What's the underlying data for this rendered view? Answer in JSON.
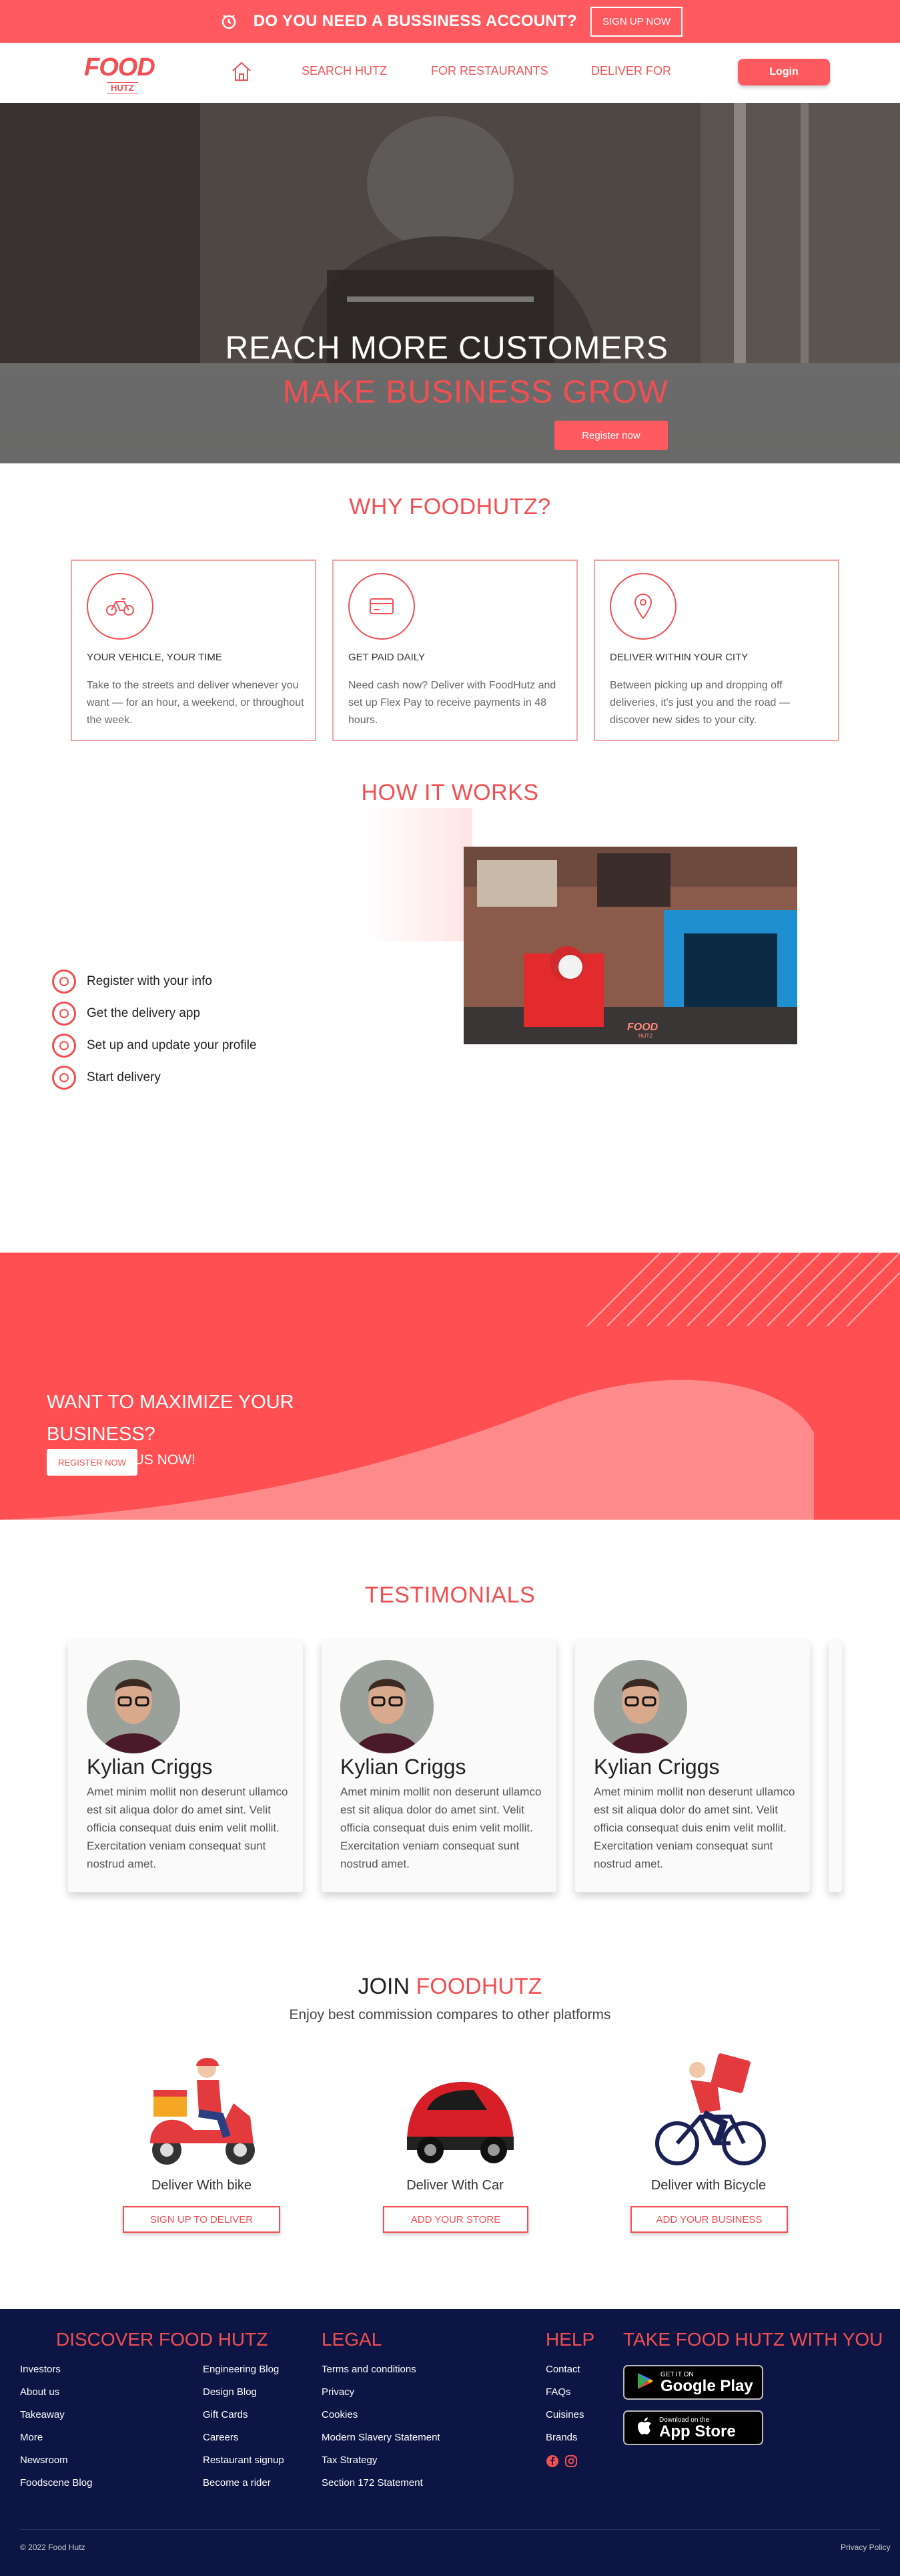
{
  "banner": {
    "text": "DO YOU NEED A BUSSINESS ACCOUNT?",
    "button": "SIGN UP NOW"
  },
  "nav": {
    "logo_top": "FOOD",
    "logo_bottom": "HUTZ",
    "links": [
      "SEARCH HUTZ",
      "FOR RESTAURANTS",
      "DELIVER FOR"
    ],
    "login": "Login"
  },
  "hero": {
    "line1": "REACH MORE CUSTOMERS",
    "line2": "MAKE BUSINESS GROW",
    "button": "Register now"
  },
  "why": {
    "title": "WHY FOODHUTZ?",
    "cards": [
      {
        "icon": "bike-icon",
        "title": "YOUR VEHICLE, YOUR TIME",
        "text": "Take to the streets and deliver whenever you want — for an hour, a weekend, or throughout the week."
      },
      {
        "icon": "card-icon",
        "title": "GET PAID DAILY",
        "text": "Need cash now? Deliver with FoodHutz and set up Flex Pay to receive payments in 48 hours."
      },
      {
        "icon": "location-icon",
        "title": "DELIVER WITHIN YOUR CITY",
        "text": "Between picking up and dropping off deliveries, it's just you and the road — discover new sides to your city."
      }
    ]
  },
  "how": {
    "title": "HOW IT WORKS",
    "steps": [
      "Register with your info",
      "Get the delivery app",
      "Set up and update your profile",
      "Start delivery"
    ],
    "photo_logo_top": "FOOD",
    "photo_logo_bottom": "HUTZ"
  },
  "band": {
    "text_line1": "WANT TO MAXIMIZE YOUR",
    "text_line2": "BUSINESS?",
    "text_line3": "WORK WITH US NOW!",
    "button": "REGISTER NOW"
  },
  "testimonials": {
    "title": "TESTIMONIALS",
    "items": [
      {
        "name": "Kylian Criggs",
        "text": "Amet minim mollit non deserunt ullamco est sit aliqua dolor do amet sint. Velit officia consequat duis enim velit mollit. Exercitation veniam consequat sunt nostrud amet."
      },
      {
        "name": "Kylian Criggs",
        "text": "Amet minim mollit non deserunt ullamco est sit aliqua dolor do amet sint. Velit officia consequat duis enim velit mollit. Exercitation veniam consequat sunt nostrud amet."
      },
      {
        "name": "Kylian Criggs",
        "text": "Amet minim mollit non deserunt ullamco est sit aliqua dolor do amet sint. Velit officia consequat duis enim velit mollit. Exercitation veniam consequat sunt nostrud amet."
      }
    ]
  },
  "join": {
    "title_a": "JOIN ",
    "title_b": "FOODHUTZ",
    "subtitle": "Enjoy best commission compares to other platforms",
    "options": [
      {
        "caption": "Deliver With bike",
        "button": "SIGN UP TO DELIVER"
      },
      {
        "caption": "Deliver With Car",
        "button": "ADD YOUR STORE"
      },
      {
        "caption": "Deliver with Bicycle",
        "button": "ADD YOUR BUSINESS"
      }
    ]
  },
  "footer": {
    "discover": {
      "title": "DISCOVER FOOD HUTZ",
      "col1": [
        "Investors",
        "About us",
        "Takeaway",
        "More",
        "Newsroom",
        "Foodscene Blog"
      ],
      "col2": [
        "Engineering Blog",
        "Design Blog",
        "Gift Cards",
        "Careers",
        "Restaurant signup",
        "Become a rider"
      ]
    },
    "legal": {
      "title": "LEGAL",
      "items": [
        "Terms and conditions",
        "Privacy",
        "Cookies",
        "Modern Slavery Statement",
        "Tax Strategy",
        "Section 172 Statement"
      ]
    },
    "help": {
      "title": "HELP",
      "items": [
        "Contact",
        "FAQs",
        "Cuisines",
        "Brands"
      ]
    },
    "app": {
      "title": "TAKE FOOD HUTZ WITH YOU",
      "google_small": "GET IT ON",
      "google_big": "Google Play",
      "apple_small": "Download on the",
      "apple_big": "App Store"
    },
    "copyright": "© 2022 Food Hutz",
    "policy": "Privacy Policy"
  },
  "colors": {
    "accent": "#ff5a5f",
    "footer": "#0c1543"
  }
}
